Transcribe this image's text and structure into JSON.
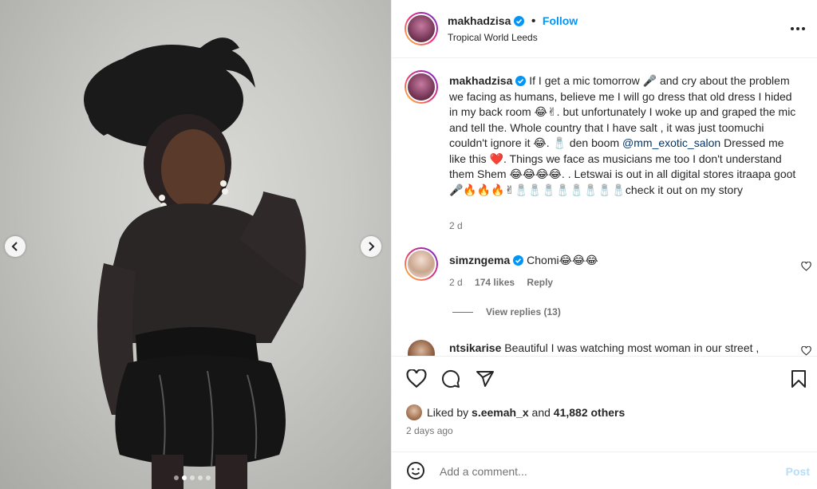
{
  "post": {
    "author": "makhadzisa",
    "follow_label": "Follow",
    "location": "Tropical World Leeds",
    "more_icon": "more-horizontal-icon"
  },
  "caption": {
    "author": "makhadzisa",
    "text_part1": "If I get a mic tomorrow 🎤 and cry about the problem we facing as humans, believe me I will go dress that old dress I hided in my back room 😂✌. but unfortunately I woke up and graped the mic and tell the. Whole country that I have salt , it was just toomuchi couldn't ignore it 😂. 🧂 den boom ",
    "mention": "@mm_exotic_salon",
    "text_part2": " Dressed me like this ❤️. Things we face as musicians me too I don't understand them Shem 😂😂😂😂. . Letswai is out in all digital stores itraapa goot 🎤🔥🔥🔥✌🧂🧂🧂🧂🧂🧂🧂🧂check it out on my story",
    "time": "2 d"
  },
  "comments": [
    {
      "user": "simzngema",
      "text": "Chomi😂😂😂",
      "time": "2 d",
      "likes": "174 likes",
      "reply_label": "Reply",
      "view_replies": "View replies (13)"
    },
    {
      "user": "ntsikarise",
      "text": "Beautiful I was watching most woman in our street ,"
    }
  ],
  "actions": {
    "like_icon": "heart-icon",
    "comment_icon": "comment-icon",
    "share_icon": "paper-plane-icon",
    "save_icon": "bookmark-icon"
  },
  "likes": {
    "prefix": "Liked by ",
    "first_user": "s.eemah_x",
    "middle": " and ",
    "count": "41,882 others"
  },
  "posted_ago": "2 days ago",
  "add_comment": {
    "placeholder": "Add a comment...",
    "post_label": "Post",
    "emoji_icon": "smiley-icon"
  },
  "carousel": {
    "slides": 5,
    "active_index": 1
  },
  "colors": {
    "link_blue": "#0095f6",
    "mention_blue": "#00376b",
    "verified_blue": "#0095f6",
    "post_disabled": "#b3dffc"
  }
}
